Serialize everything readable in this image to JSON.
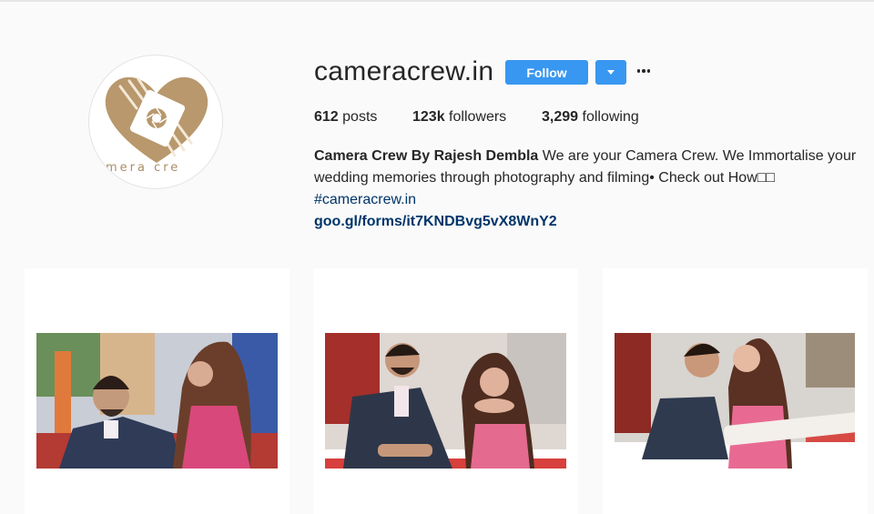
{
  "profile": {
    "username": "cameracrew.in",
    "avatar_wordmark": "mera cre",
    "follow_label": "Follow",
    "more_icon": "ellipsis-icon",
    "dropdown_icon": "caret-down-icon"
  },
  "stats": {
    "posts_count": "612",
    "posts_label": " posts",
    "followers_count": "123k",
    "followers_label": " followers",
    "following_count": "3,299",
    "following_label": " following"
  },
  "bio": {
    "full_name": "Camera Crew By Rajesh Dembla",
    "text": " We are your Camera Crew. We Immortalise your wedding memories through photography and filming• Check out How□□",
    "hashtag": "#cameracrew.in",
    "link": "goo.gl/forms/it7KNDBvg5vX8WnY2"
  },
  "colors": {
    "accent": "#3897f0",
    "link": "#003569",
    "avatar_gold": "#b8986c"
  },
  "posts": [
    {
      "alt": "couple photo 1"
    },
    {
      "alt": "couple photo 2"
    },
    {
      "alt": "couple photo 3"
    }
  ]
}
